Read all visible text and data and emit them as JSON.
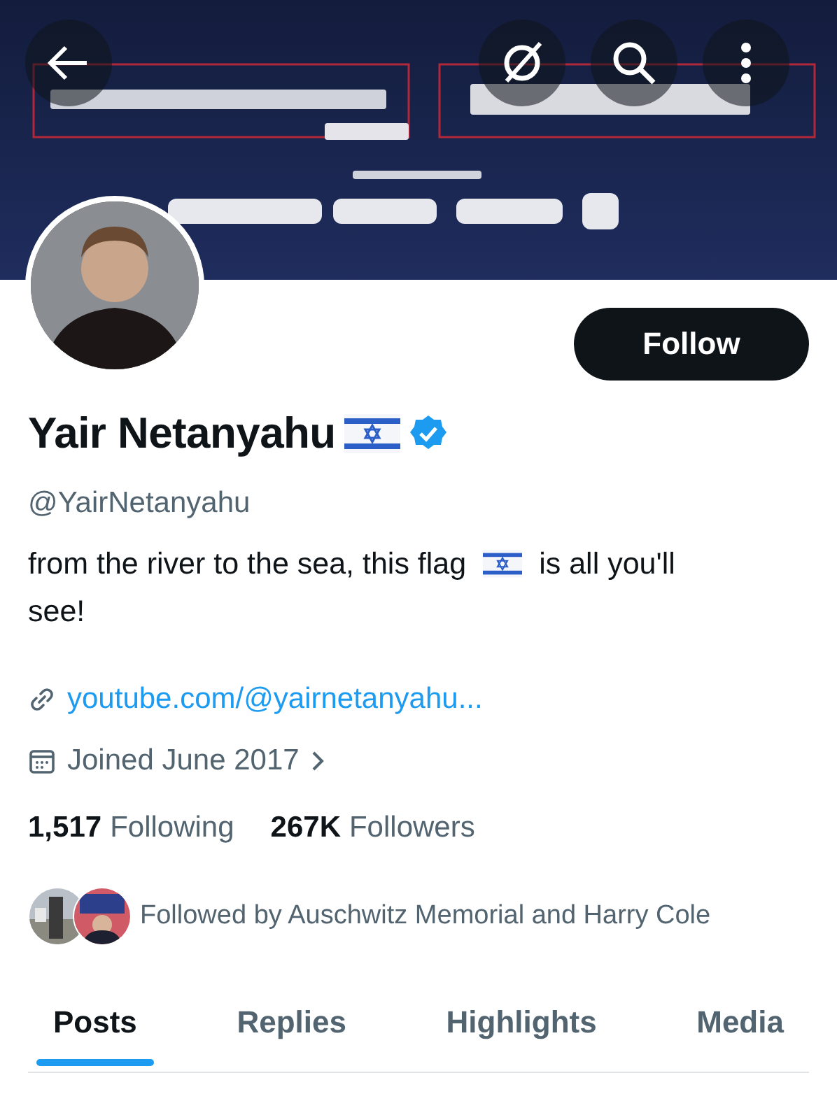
{
  "header": {
    "buttons": [
      {
        "kind": "back"
      },
      {
        "kind": "grok"
      },
      {
        "kind": "search"
      },
      {
        "kind": "more"
      }
    ]
  },
  "profile": {
    "follow_label": "Follow",
    "name": "Yair Netanyahu",
    "verified": true,
    "handle": "@YairNetanyahu",
    "bio": [
      {
        "kind": "text",
        "text": "from the river to the sea, this flag"
      },
      {
        "kind": "flag"
      },
      {
        "kind": "text",
        "text": "is all you'll"
      },
      {
        "kind": "text",
        "text": "see!"
      }
    ],
    "link": "youtube.com/@yairnetanyahu...",
    "joined": "Joined June 2017",
    "stats": [
      {
        "count": "1,517",
        "label": "Following"
      },
      {
        "count": "267K",
        "label": "Followers"
      }
    ],
    "followed_by": "Followed by Auschwitz Memorial and Harry Cole"
  },
  "tabs": [
    {
      "label": "Posts",
      "selected": true
    },
    {
      "label": "Replies",
      "selected": false
    },
    {
      "label": "Highlights",
      "selected": false
    },
    {
      "label": "Media",
      "selected": false
    }
  ]
}
